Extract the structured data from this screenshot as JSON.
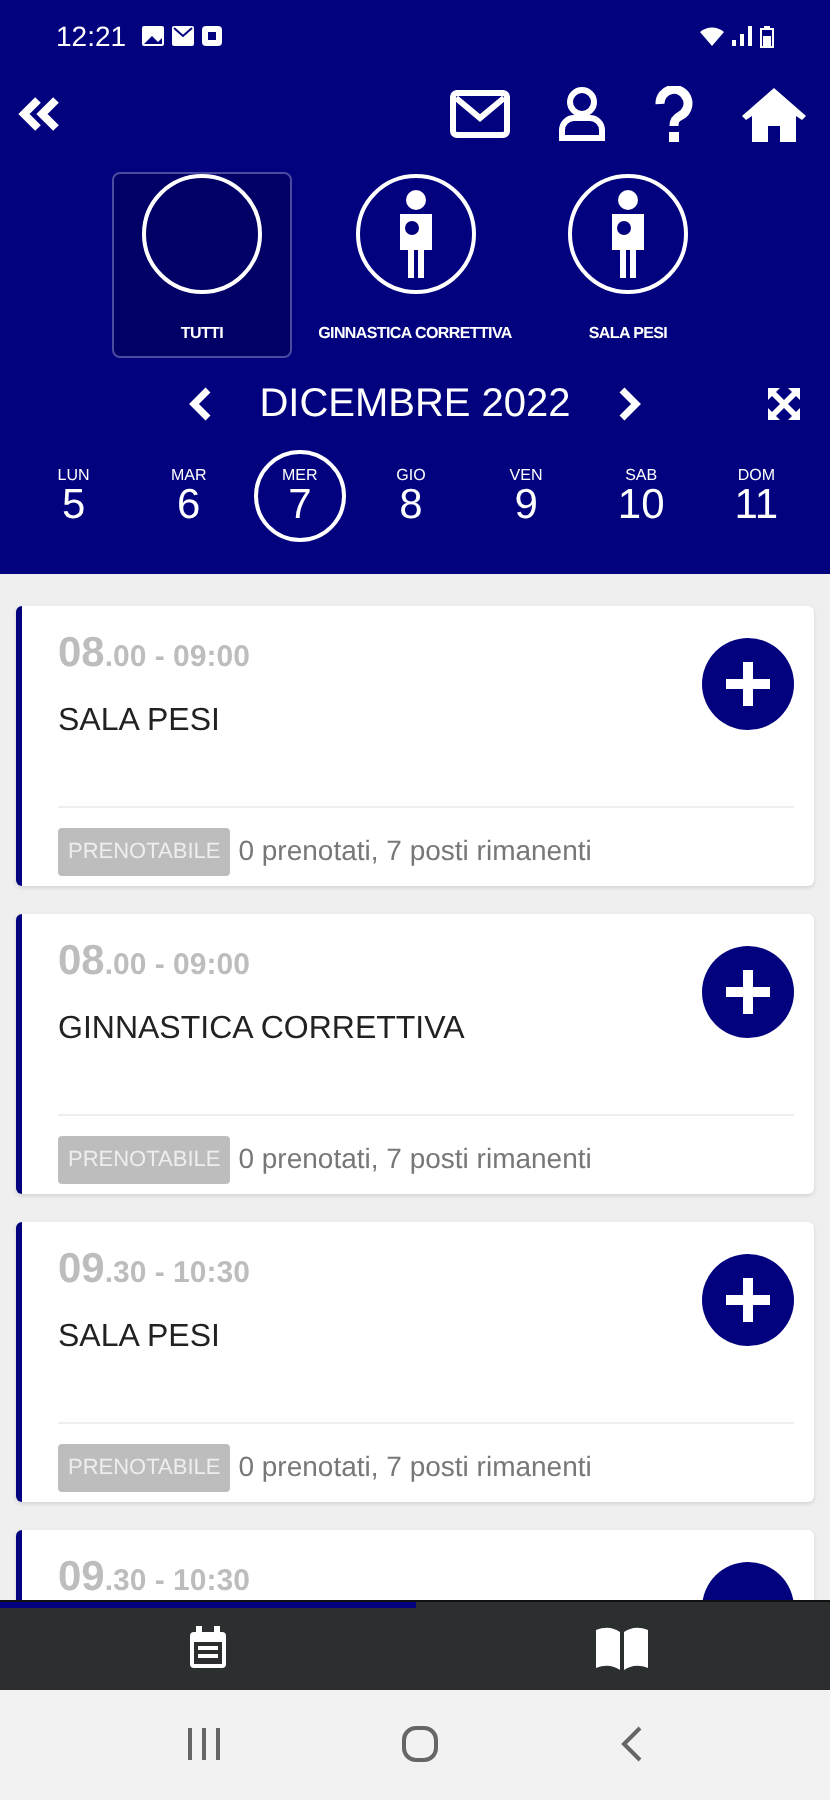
{
  "status_bar": {
    "time": "12:21"
  },
  "filters": [
    {
      "label": "TUTTI",
      "kind": "all",
      "selected": true
    },
    {
      "label": "GINNASTICA CORRETTIVA",
      "kind": "person",
      "selected": false
    },
    {
      "label": "SALA PESI",
      "kind": "person",
      "selected": false
    }
  ],
  "month": "DICEMBRE 2022",
  "days": [
    {
      "weekday": "LUN",
      "day": "5",
      "selected": false
    },
    {
      "weekday": "MAR",
      "day": "6",
      "selected": false
    },
    {
      "weekday": "MER",
      "day": "7",
      "selected": true
    },
    {
      "weekday": "GIO",
      "day": "8",
      "selected": false
    },
    {
      "weekday": "VEN",
      "day": "9",
      "selected": false
    },
    {
      "weekday": "SAB",
      "day": "10",
      "selected": false
    },
    {
      "weekday": "DOM",
      "day": "11",
      "selected": false
    }
  ],
  "sessions": [
    {
      "hour": "08",
      "rest": ".00 - 09:00",
      "title": "SALA PESI",
      "badge": "PRENOTABILE",
      "info": "0 prenotati, 7 posti rimanenti"
    },
    {
      "hour": "08",
      "rest": ".00 - 09:00",
      "title": "GINNASTICA CORRETTIVA",
      "badge": "PRENOTABILE",
      "info": "0 prenotati, 7 posti rimanenti"
    },
    {
      "hour": "09",
      "rest": ".30 - 10:30",
      "title": "SALA PESI",
      "badge": "PRENOTABILE",
      "info": "0 prenotati, 7 posti rimanenti"
    },
    {
      "hour": "09",
      "rest": ".30 - 10:30"
    }
  ],
  "bottom_tabs": [
    {
      "kind": "calendar",
      "selected": true
    },
    {
      "kind": "book",
      "selected": false
    }
  ]
}
